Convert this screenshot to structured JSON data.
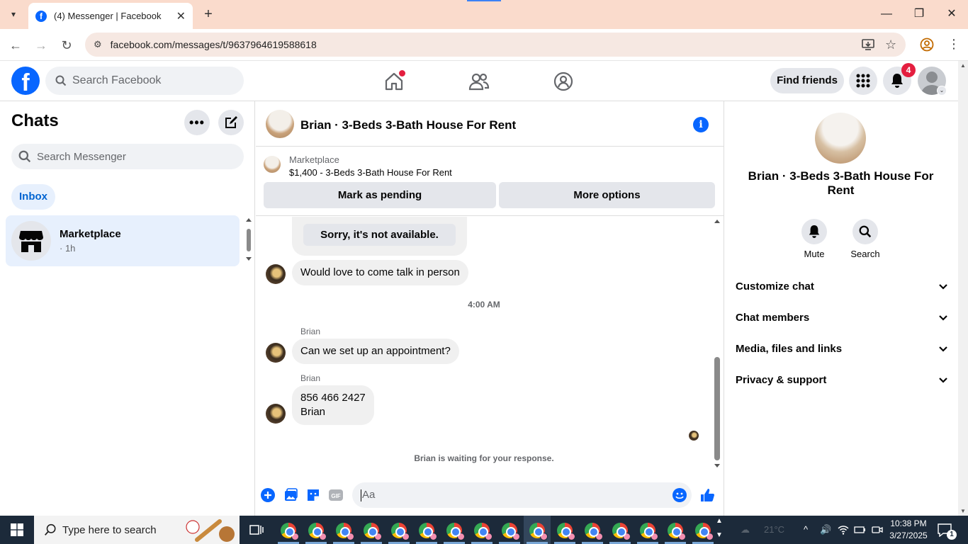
{
  "browser": {
    "tab_title": "(4) Messenger | Facebook",
    "url": "facebook.com/messages/t/9637964619588618"
  },
  "header": {
    "search_placeholder": "Search Facebook",
    "find_friends": "Find friends",
    "notification_count": "4"
  },
  "sidebar": {
    "title": "Chats",
    "search_placeholder": "Search Messenger",
    "filter": "Inbox",
    "chats": [
      {
        "name": "Marketplace",
        "time": "· 1h"
      }
    ]
  },
  "chat": {
    "title": "Brian · 3-Beds 3-Bath House For Rent",
    "marketplace_label": "Marketplace",
    "listing": "$1,400 - 3-Beds 3-Bath House For Rent",
    "mark_pending": "Mark as pending",
    "more_options": "More options",
    "messages": {
      "quick_reply": "Sorry, it's not available.",
      "m1": "Would love to come talk in person",
      "timestamp": "4:00 AM",
      "sender": "Brian",
      "m2": "Can we set up an appointment?",
      "m3_line1": "856 466 2427",
      "m3_line2": "Brian"
    },
    "waiting": "Brian is waiting for your response.",
    "composer_placeholder": "Aa"
  },
  "details": {
    "name": "Brian · 3-Beds 3-Bath House For Rent",
    "mute": "Mute",
    "search": "Search",
    "sections": [
      "Customize chat",
      "Chat members",
      "Media, files and links",
      "Privacy & support"
    ]
  },
  "taskbar": {
    "search_placeholder": "Type here to search",
    "weather": "21°C",
    "time": "10:38 PM",
    "date": "3/27/2025",
    "notifications": "1"
  },
  "colors": {
    "accent": "#0866ff",
    "tabbar": "#fadbcc",
    "selected_chat": "#e7f0fd",
    "bubble": "#f0f0f0",
    "taskbar": "#1c2a3a"
  }
}
